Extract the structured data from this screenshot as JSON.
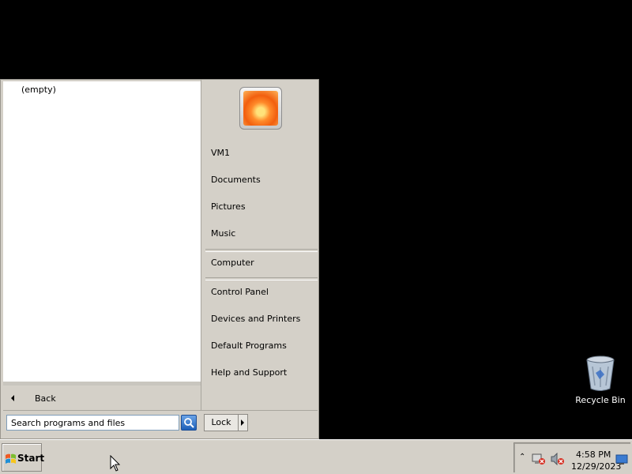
{
  "start_menu": {
    "left_pane": {
      "empty_label": "(empty)",
      "back_label": "Back",
      "search": {
        "placeholder": "Search programs and files",
        "value": ""
      }
    },
    "right_pane": {
      "items": [
        {
          "label": "VM1"
        },
        {
          "label": "Documents"
        },
        {
          "label": "Pictures"
        },
        {
          "label": "Music"
        },
        {
          "label": "Computer"
        },
        {
          "label": "Control Panel"
        },
        {
          "label": "Devices and Printers"
        },
        {
          "label": "Default Programs"
        },
        {
          "label": "Help and Support"
        }
      ],
      "lock_label": "Lock"
    }
  },
  "desktop": {
    "icons": [
      {
        "label": "Recycle Bin",
        "icon": "recycle-bin-icon"
      }
    ]
  },
  "taskbar": {
    "start_label": "Start",
    "tray": {
      "time": "4:58 PM",
      "date": "12/29/2023",
      "icons": [
        "tray-chevron-icon",
        "network-disconnected-icon",
        "volume-muted-icon",
        "show-desktop-icon"
      ]
    }
  },
  "colors": {
    "desktop_background": "#000000",
    "menu_background": "#d4d0c8",
    "left_pane_background": "#ffffff"
  }
}
